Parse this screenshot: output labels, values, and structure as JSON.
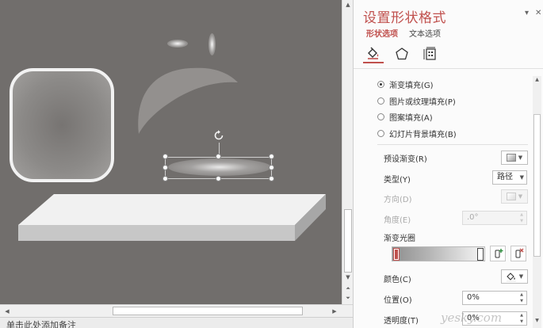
{
  "status_bar": {
    "text": "单击此处添加备注"
  },
  "pane": {
    "title": "设置形状格式",
    "pin_glyph": "▾",
    "close_glyph": "✕",
    "tabs": [
      {
        "label": "形状选项",
        "active": true
      },
      {
        "label": "文本选项",
        "active": false
      }
    ],
    "category_icons": [
      {
        "name": "fill-line-icon",
        "active": true
      },
      {
        "name": "effects-pentagon-icon",
        "active": false
      },
      {
        "name": "size-properties-icon",
        "active": false
      }
    ],
    "fill_options": [
      {
        "label": "渐变填充(G)",
        "checked": true
      },
      {
        "label": "图片或纹理填充(P)",
        "checked": false
      },
      {
        "label": "图案填充(A)",
        "checked": false
      },
      {
        "label": "幻灯片背景填充(B)",
        "checked": false
      }
    ],
    "preset_gradient": {
      "label": "预设渐变(R)"
    },
    "type": {
      "label": "类型(Y)",
      "value": "路径"
    },
    "direction": {
      "label": "方向(D)",
      "disabled": true
    },
    "angle": {
      "label": "角度(E)",
      "value": ".0°",
      "disabled": true
    },
    "gradient_stops": {
      "label": "渐变光圈",
      "stops": [
        0.0,
        1.0
      ],
      "selected_index": 0,
      "add_icon": "add-gradient-stop-icon",
      "remove_icon": "remove-gradient-stop-icon"
    },
    "color": {
      "label": "颜色(C)"
    },
    "position": {
      "label": "位置(O)",
      "value": "0%"
    },
    "transparency": {
      "label": "透明度(T)",
      "value": "0%"
    }
  },
  "watermark": "yesky.com",
  "colors": {
    "accent": "#c0504d",
    "canvas_bg": "#716e6c",
    "pane_bg": "#fbfbfb"
  }
}
